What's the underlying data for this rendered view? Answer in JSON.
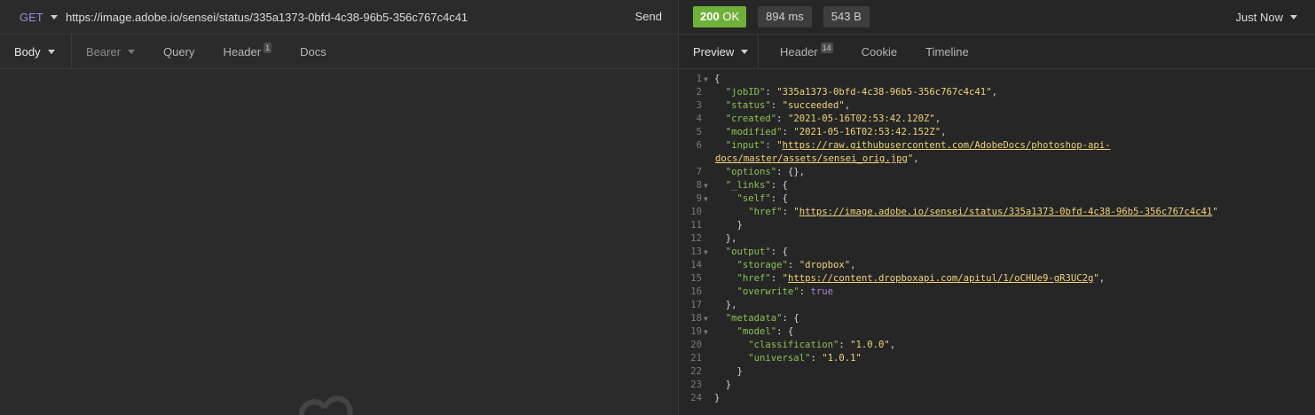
{
  "request": {
    "method": "GET",
    "url": "https://image.adobe.io/sensei/status/335a1373-0bfd-4c38-96b5-356c767c4c41",
    "send_label": "Send",
    "tabs": [
      {
        "label": "Body"
      },
      {
        "label": "Bearer"
      },
      {
        "label": "Query"
      },
      {
        "label": "Header",
        "count": "1"
      },
      {
        "label": "Docs"
      }
    ]
  },
  "response": {
    "status_code": "200",
    "status_text": "OK",
    "time": "894 ms",
    "size": "543 B",
    "timestamp": "Just Now",
    "tabs": [
      {
        "label": "Preview"
      },
      {
        "label": "Header",
        "count": "14"
      },
      {
        "label": "Cookie"
      },
      {
        "label": "Timeline"
      }
    ],
    "body": {
      "jobID": "335a1373-0bfd-4c38-96b5-356c767c4c41",
      "status": "succeeded",
      "created": "2021-05-16T02:53:42.120Z",
      "modified": "2021-05-16T02:53:42.152Z",
      "input_part1": "https://raw.githubusercontent.com/AdobeDocs/photoshop-api-",
      "input_part2": "docs/master/assets/sensei_orig.jpg",
      "self_href": "https://image.adobe.io/sensei/status/335a1373-0bfd-4c38-96b5-356c767c4c41",
      "storage": "dropbox",
      "output_href": "https://content.dropboxapi.com/apitul/1/oCHUe9-gR3UC2g",
      "overwrite": "true",
      "classification": "1.0.0",
      "universal": "1.0.1"
    },
    "line_numbers": [
      "1",
      "2",
      "3",
      "4",
      "5",
      "6",
      "7",
      "8",
      "9",
      "10",
      "11",
      "12",
      "13",
      "14",
      "15",
      "16",
      "17",
      "18",
      "19",
      "20",
      "21",
      "22",
      "23",
      "24"
    ]
  },
  "colors": {
    "method": "#9a8cd8",
    "status_ok": "#6fb03a",
    "json_key": "#8cc152",
    "json_string": "#f0d47a",
    "json_bool": "#a48ad8"
  }
}
